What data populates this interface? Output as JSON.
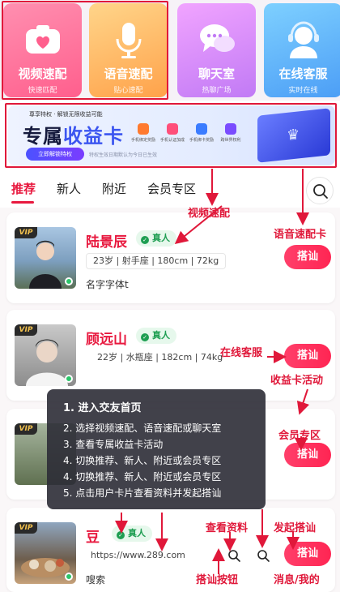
{
  "tiles": [
    {
      "title": "视频速配",
      "sub": "快速匹配"
    },
    {
      "title": "语音速配",
      "sub": "贴心速配"
    },
    {
      "title": "聊天室",
      "sub": "热聊广场"
    },
    {
      "title": "在线客服",
      "sub": "实时在线"
    }
  ],
  "banner": {
    "top_text": "尊享特权 · 解锁无限收益可能",
    "title_left": "专属",
    "title_hl": "收益卡",
    "button": "立即解锁特权",
    "note": "特权生效日期默认为今日已生效",
    "features": [
      "手机绑定奖励",
      "手机认证加成",
      "手机绑卡奖励",
      "跨世界权利"
    ]
  },
  "tabs": [
    "推荐",
    "新人",
    "附近",
    "会员专区"
  ],
  "cards": [
    {
      "vip": "VIP",
      "name": "陆景辰",
      "verify": "真人",
      "tags": "23岁 | 射手座 | 180cm | 72kg",
      "bio": "名字字体t",
      "button": "搭讪"
    },
    {
      "vip": "VIP",
      "name": "顾远山",
      "verify": "真人",
      "tags": "22岁 | 水瓶座 | 182cm | 74kg",
      "bio": "",
      "button": "搭讪"
    },
    {
      "vip": "VIP",
      "name": "",
      "verify": "",
      "tags": "",
      "bio": "",
      "button": "搭讪"
    },
    {
      "vip": "VIP",
      "name": "豆",
      "verify": "真人",
      "url": "https://www.289.com",
      "bio": "嗖索",
      "button": "搭讪"
    }
  ],
  "popup": {
    "steps": [
      "1. 进入交友首页",
      "2. 选择视频速配、语音速配或聊天室",
      "3. 查看专属收益卡活动",
      "4. 切换推荐、新人、附近或会员专区",
      "4. 切换推荐、新人、附近或会员专区",
      "5. 点击用户卡片查看资料并发起搭讪"
    ]
  },
  "annotations": {
    "video": "视频速配",
    "voice_card": "语音速配卡",
    "service": "在线客服",
    "income": "收益卡活动",
    "vip_zone": "会员专区",
    "view_profile": "查看资料",
    "start_chat": "发起搭讪",
    "chat_button": "搭讪按钮",
    "messages": "消息/我的"
  },
  "colors": {
    "accent": "#e8193f",
    "annotation": "#e0183a",
    "verify": "#1e9e52"
  }
}
